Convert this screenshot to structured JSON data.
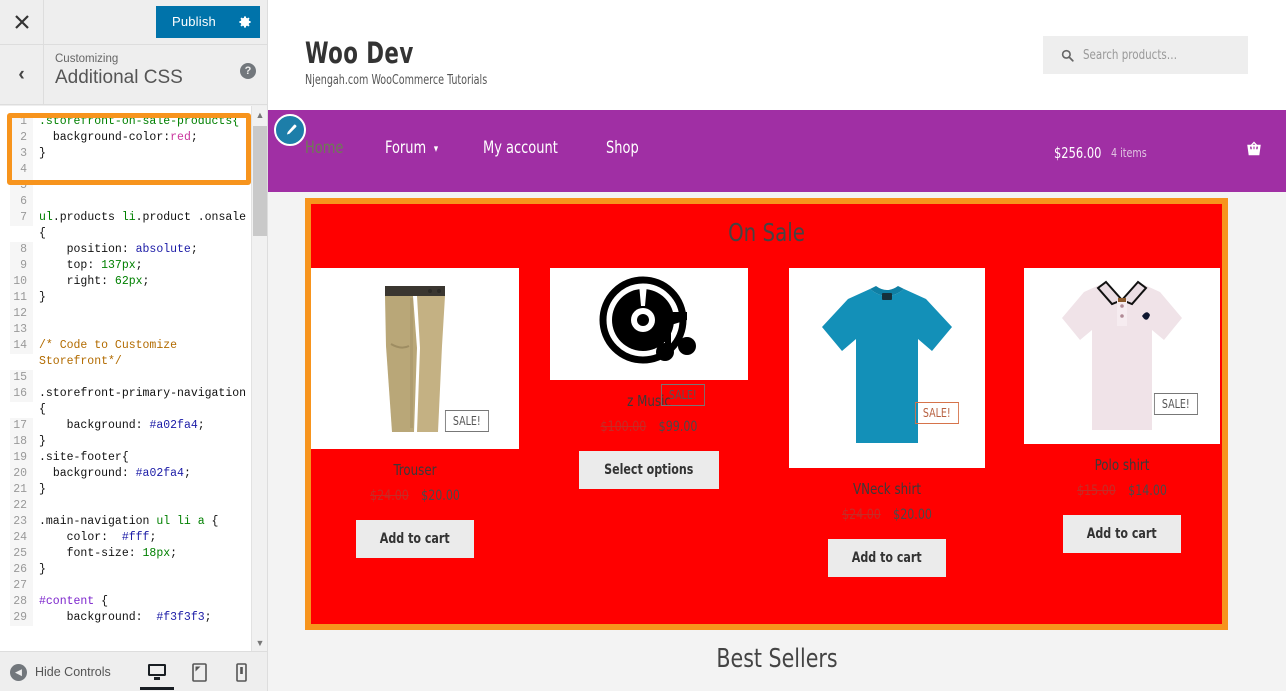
{
  "customizer": {
    "close_label": "Close",
    "publish_label": "Publish",
    "gear_label": "Publish settings",
    "breadcrumb": "Customizing",
    "panel_title": "Additional CSS",
    "help_label": "?",
    "hide_controls_label": "Hide Controls",
    "devices": [
      {
        "name": "desktop",
        "active": true
      },
      {
        "name": "tablet",
        "active": false
      },
      {
        "name": "mobile",
        "active": false
      }
    ],
    "code_lines": [
      {
        "num": "1",
        "segments": [
          {
            "t": ".storefront-on-sale-products{",
            "c": "c-sel"
          }
        ]
      },
      {
        "num": "2",
        "segments": [
          {
            "t": "  background-color:",
            "c": "c-prop"
          },
          {
            "t": "red",
            "c": "c-red"
          },
          {
            "t": ";",
            "c": "c-prop"
          }
        ]
      },
      {
        "num": "3",
        "segments": [
          {
            "t": "}",
            "c": "c-prop"
          }
        ]
      },
      {
        "num": "4",
        "segments": [
          {
            "t": "",
            "c": "c-prop"
          }
        ]
      },
      {
        "num": "5",
        "segments": [
          {
            "t": "",
            "c": "c-prop"
          }
        ]
      },
      {
        "num": "6",
        "segments": [
          {
            "t": "",
            "c": "c-prop"
          }
        ]
      },
      {
        "num": "7",
        "segments": [
          {
            "t": "ul",
            "c": "c-sel"
          },
          {
            "t": ".products ",
            "c": "c-prop"
          },
          {
            "t": "li",
            "c": "c-sel"
          },
          {
            "t": ".product .onsale",
            "c": "c-prop"
          },
          {
            "t": "\n{",
            "c": "c-prop"
          }
        ]
      },
      {
        "num": "8",
        "segments": [
          {
            "t": "    position: ",
            "c": "c-prop"
          },
          {
            "t": "absolute",
            "c": "c-val"
          },
          {
            "t": ";",
            "c": "c-prop"
          }
        ]
      },
      {
        "num": "9",
        "segments": [
          {
            "t": "    top: ",
            "c": "c-prop"
          },
          {
            "t": "137px",
            "c": "c-sel"
          },
          {
            "t": ";",
            "c": "c-prop"
          }
        ]
      },
      {
        "num": "10",
        "segments": [
          {
            "t": "    right: ",
            "c": "c-prop"
          },
          {
            "t": "62px",
            "c": "c-sel"
          },
          {
            "t": ";",
            "c": "c-prop"
          }
        ]
      },
      {
        "num": "11",
        "segments": [
          {
            "t": "}",
            "c": "c-prop"
          }
        ]
      },
      {
        "num": "12",
        "segments": [
          {
            "t": "",
            "c": "c-prop"
          }
        ]
      },
      {
        "num": "13",
        "segments": [
          {
            "t": "",
            "c": "c-prop"
          }
        ]
      },
      {
        "num": "14",
        "segments": [
          {
            "t": "/* Code to Customize\nStorefront*/",
            "c": "c-com"
          }
        ]
      },
      {
        "num": "15",
        "segments": [
          {
            "t": "",
            "c": "c-prop"
          }
        ]
      },
      {
        "num": "16",
        "segments": [
          {
            "t": ".storefront-primary-navigation\n{",
            "c": "c-prop"
          }
        ]
      },
      {
        "num": "17",
        "segments": [
          {
            "t": "    background: ",
            "c": "c-prop"
          },
          {
            "t": "#a02fa4",
            "c": "c-hash"
          },
          {
            "t": ";",
            "c": "c-prop"
          }
        ]
      },
      {
        "num": "18",
        "segments": [
          {
            "t": "}",
            "c": "c-prop"
          }
        ]
      },
      {
        "num": "19",
        "segments": [
          {
            "t": ".site-footer{",
            "c": "c-prop"
          }
        ]
      },
      {
        "num": "20",
        "segments": [
          {
            "t": "  background: ",
            "c": "c-prop"
          },
          {
            "t": "#a02fa4",
            "c": "c-hash"
          },
          {
            "t": ";",
            "c": "c-prop"
          }
        ]
      },
      {
        "num": "21",
        "segments": [
          {
            "t": "}",
            "c": "c-prop"
          }
        ]
      },
      {
        "num": "22",
        "segments": [
          {
            "t": "",
            "c": "c-prop"
          }
        ]
      },
      {
        "num": "23",
        "segments": [
          {
            "t": ".main-navigation ",
            "c": "c-prop"
          },
          {
            "t": "ul li a",
            "c": "c-sel"
          },
          {
            "t": " {",
            "c": "c-prop"
          }
        ]
      },
      {
        "num": "24",
        "segments": [
          {
            "t": "    color:  ",
            "c": "c-prop"
          },
          {
            "t": "#fff",
            "c": "c-hash"
          },
          {
            "t": ";",
            "c": "c-prop"
          }
        ]
      },
      {
        "num": "25",
        "segments": [
          {
            "t": "    font-size: ",
            "c": "c-prop"
          },
          {
            "t": "18px",
            "c": "c-sel"
          },
          {
            "t": ";",
            "c": "c-prop"
          }
        ]
      },
      {
        "num": "26",
        "segments": [
          {
            "t": "}",
            "c": "c-prop"
          }
        ]
      },
      {
        "num": "27",
        "segments": [
          {
            "t": "",
            "c": "c-prop"
          }
        ]
      },
      {
        "num": "28",
        "segments": [
          {
            "t": "#content",
            "c": "c-id"
          },
          {
            "t": " {",
            "c": "c-prop"
          }
        ]
      },
      {
        "num": "29",
        "segments": [
          {
            "t": "    background:  ",
            "c": "c-prop"
          },
          {
            "t": "#f3f3f3",
            "c": "c-hash"
          },
          {
            "t": ";",
            "c": "c-prop"
          }
        ]
      }
    ]
  },
  "site": {
    "title": "Woo Dev",
    "description": "Njengah.com WooCommerce Tutorials",
    "search_placeholder": "Search products…",
    "search_value": "",
    "nav": [
      {
        "label": "Home",
        "current": true,
        "has_caret": false
      },
      {
        "label": "Forum",
        "current": false,
        "has_caret": true
      },
      {
        "label": "My account",
        "current": false,
        "has_caret": false
      },
      {
        "label": "Shop",
        "current": false,
        "has_caret": false
      }
    ],
    "cart": {
      "total": "$256.00",
      "count": "4 items"
    }
  },
  "sale_section": {
    "heading": "On Sale",
    "background_color": "#ff0000",
    "highlight_color": "#f7941d",
    "badge_label": "SALE!",
    "products": [
      {
        "name": "Trouser",
        "price_old": "$24.00",
        "price_new": "$20.00",
        "button": "Add to cart",
        "image": "trouser-image"
      },
      {
        "name": "z Music",
        "price_old": "$100.00",
        "price_new": "$99.00",
        "button": "Select options",
        "image": "music-cd-image"
      },
      {
        "name": "VNeck shirt",
        "price_old": "$24.00",
        "price_new": "$20.00",
        "button": "Add to cart",
        "image": "vneck-shirt-image"
      },
      {
        "name": "Polo shirt",
        "price_old": "$15.00",
        "price_new": "$14.00",
        "button": "Add to cart",
        "image": "polo-shirt-image"
      }
    ]
  },
  "best_sellers_heading": "Best Sellers"
}
